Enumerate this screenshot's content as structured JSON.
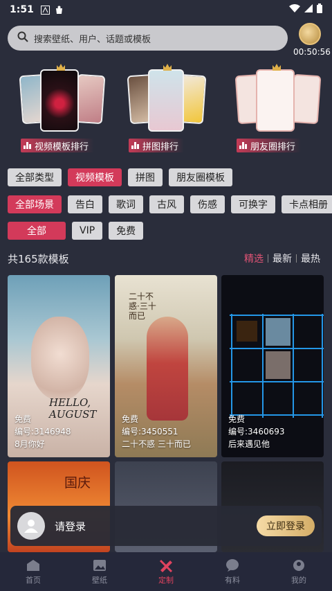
{
  "status": {
    "time": "1:51"
  },
  "search": {
    "placeholder": "搜索壁纸、用户、话题或模板"
  },
  "badge": {
    "timer": "00:50:56"
  },
  "rankings": [
    {
      "label": "视频模板排行"
    },
    {
      "label": "拼图排行"
    },
    {
      "label": "朋友圈排行"
    }
  ],
  "filters": {
    "types": [
      "全部类型",
      "视频模板",
      "拼图",
      "朋友圈模板"
    ],
    "scenes": [
      "全部场景",
      "告白",
      "歌词",
      "古风",
      "伤感",
      "可换字",
      "卡点相册"
    ],
    "prices": [
      "全部",
      "VIP",
      "免费"
    ]
  },
  "count_text": "共165款模板",
  "sort": [
    "精选",
    "最新",
    "最热"
  ],
  "tiles": [
    {
      "price": "免费",
      "id": "编号:3146948",
      "name": "8月你好"
    },
    {
      "price": "免费",
      "id": "编号:3450551",
      "name": "二十不惑 三十而已"
    },
    {
      "price": "免费",
      "id": "编号:3460693",
      "name": "后来遇见他"
    }
  ],
  "tile_overlay_text": {
    "hello": "HELLO,",
    "august": "AUGUST",
    "poster": "二十不惑·三十而已",
    "guoqing": "国庆"
  },
  "login": {
    "prompt": "请登录",
    "button": "立即登录"
  },
  "nav": [
    {
      "label": "首页",
      "icon": "home-icon"
    },
    {
      "label": "壁纸",
      "icon": "wallpaper-icon"
    },
    {
      "label": "定制",
      "icon": "custom-icon"
    },
    {
      "label": "有料",
      "icon": "chat-icon"
    },
    {
      "label": "我的",
      "icon": "profile-icon"
    }
  ],
  "colors": {
    "accent": "#d33a5a",
    "background": "#2a2d3b",
    "gold": "#d4ad67"
  }
}
